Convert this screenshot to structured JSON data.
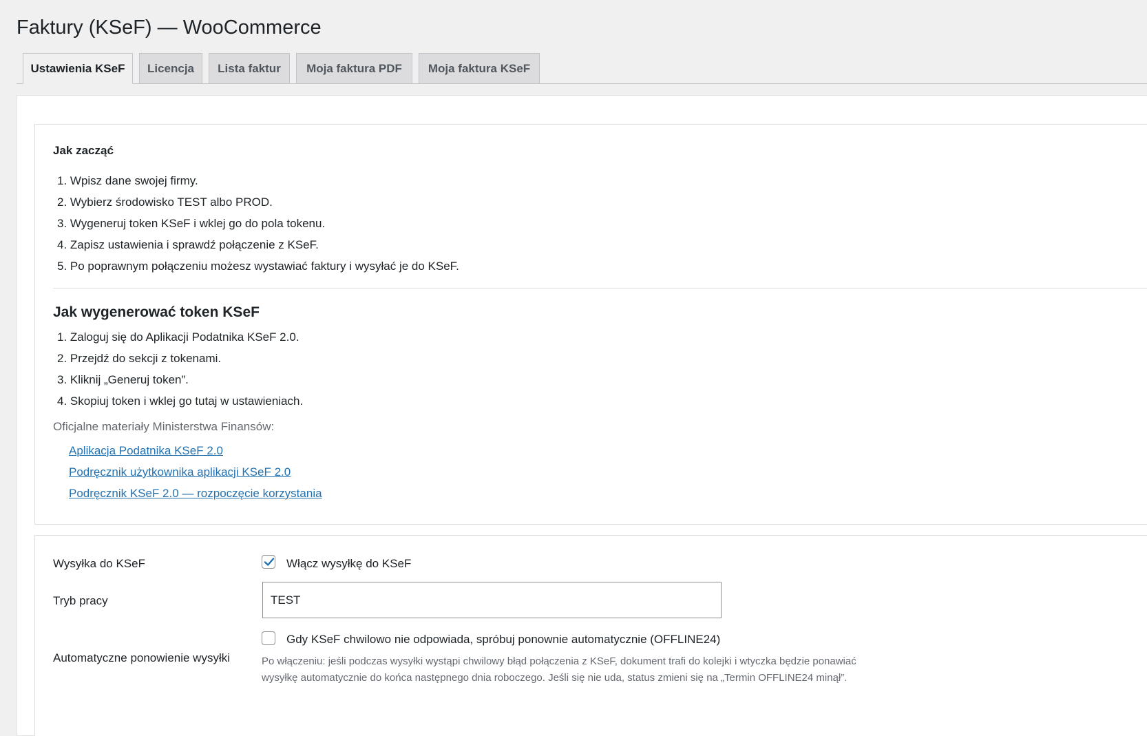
{
  "page": {
    "title": "Faktury (KSeF) — WooCommerce"
  },
  "tabs": [
    {
      "label": "Ustawienia KSeF",
      "active": true
    },
    {
      "label": "Licencja",
      "active": false
    },
    {
      "label": "Lista faktur",
      "active": false
    },
    {
      "label": "Moja faktura PDF",
      "active": false
    },
    {
      "label": "Moja faktura KSeF",
      "active": false
    }
  ],
  "getting_started": {
    "heading": "Jak zacząć",
    "steps": [
      "1. Wpisz dane swojej firmy.",
      "2. Wybierz środowisko TEST albo PROD.",
      "3. Wygeneruj token KSeF i wklej go do pola tokenu.",
      "4. Zapisz ustawienia i sprawdź połączenie z KSeF.",
      "5. Po poprawnym połączeniu możesz wystawiać faktury i wysyłać je do KSeF."
    ]
  },
  "token_guide": {
    "heading": "Jak wygenerować token KSeF",
    "steps": [
      "1. Zaloguj się do Aplikacji Podatnika KSeF 2.0.",
      "2. Przejdź do sekcji z tokenami.",
      "3. Kliknij „Generuj token”.",
      "4. Skopiuj token i wklej go tutaj w ustawieniach."
    ],
    "materials_label": "Oficjalne materiały Ministerstwa Finansów:",
    "links": [
      "Aplikacja Podatnika KSeF 2.0",
      "Podręcznik użytkownika aplikacji KSeF 2.0",
      "Podręcznik KSeF 2.0 — rozpoczęcie korzystania"
    ]
  },
  "settings": {
    "send_label": "Wysyłka do KSeF",
    "send_checkbox_label": "Włącz wysyłkę do KSeF",
    "send_checked": true,
    "mode_label": "Tryb pracy",
    "mode_value": "TEST",
    "retry_label": "Automatyczne ponowienie wysyłki",
    "retry_checkbox_label": "Gdy KSeF chwilowo nie odpowiada, spróbuj ponownie automatycznie (OFFLINE24)",
    "retry_checked": false,
    "retry_description_line1": "Po włączeniu: jeśli podczas wysyłki wystąpi chwilowy błąd połączenia z KSeF, dokument trafi do kolejki i wtyczka będzie ponawiać",
    "retry_description_line2": "wysyłkę automatycznie do końca następnego dnia roboczego. Jeśli się nie uda, status zmieni się na „Termin OFFLINE24 minął”."
  },
  "colors": {
    "background": "#f0f0f1",
    "panel": "#ffffff",
    "link": "#2271b1",
    "checkmark": "#2271b1",
    "muted_text": "#646970"
  },
  "icons": {
    "checkmark": "checkmark-icon"
  }
}
